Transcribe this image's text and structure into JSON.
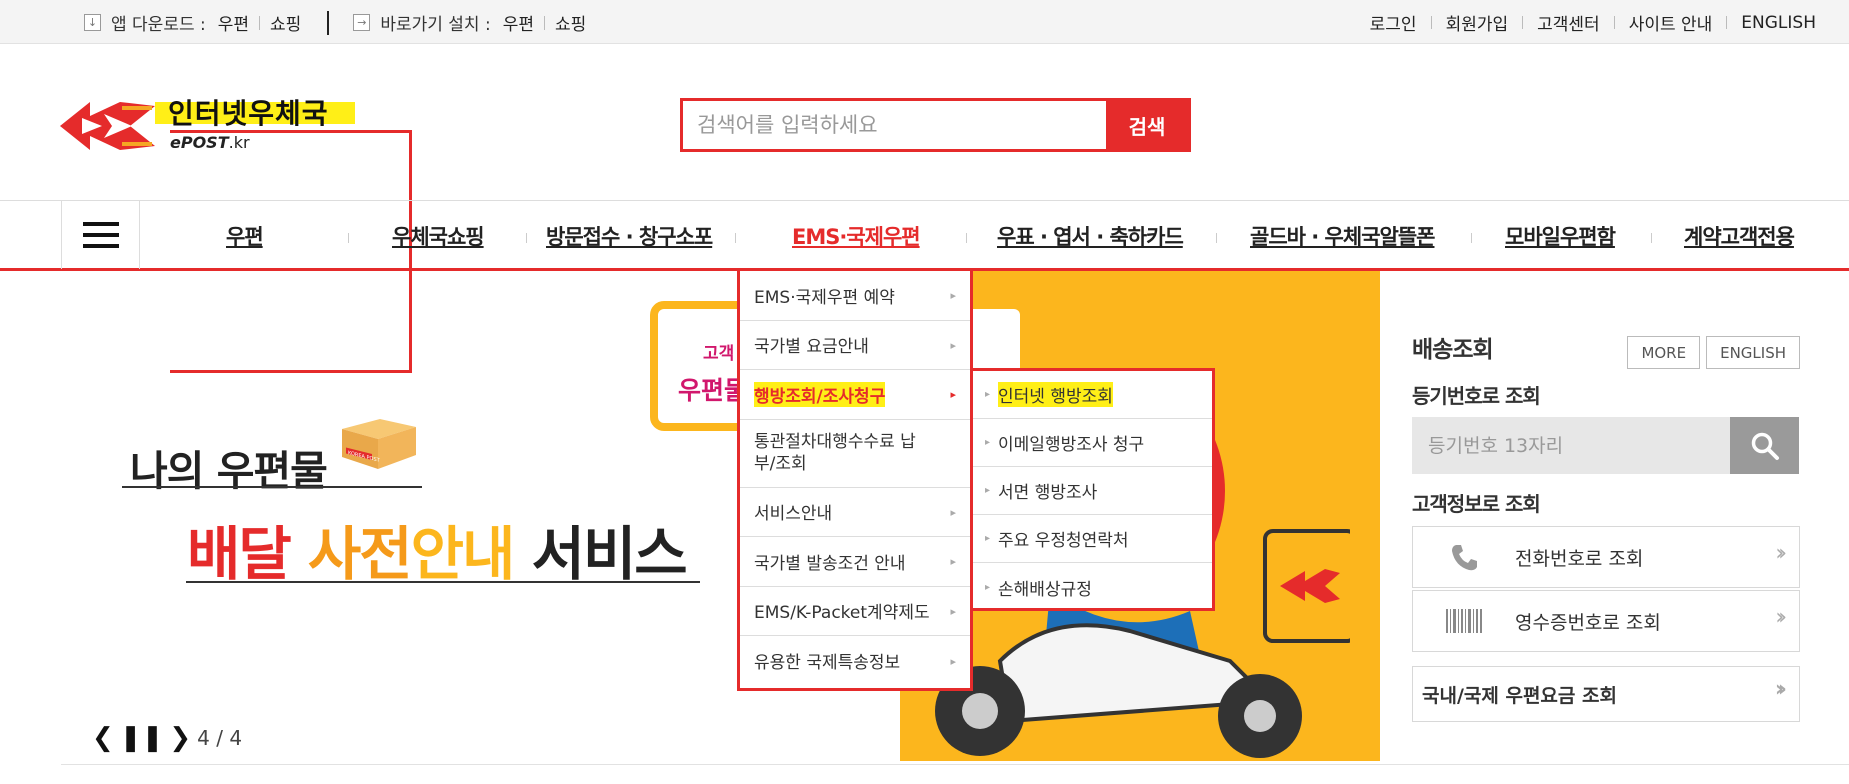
{
  "topbar": {
    "app_download_label": "앱 다운로드 :",
    "app_links": [
      "우편",
      "쇼핑"
    ],
    "shortcut_label": "바로가기 설치 :",
    "shortcut_links": [
      "우편",
      "쇼핑"
    ],
    "right_links": [
      "로그인",
      "회원가입",
      "고객센터",
      "사이트 안내",
      "ENGLISH"
    ]
  },
  "logo": {
    "brand": "인터넷우체국",
    "sub_main": "ePOST",
    "sub_tld": ".kr"
  },
  "search": {
    "placeholder": "검색어를 입력하세요",
    "button": "검색"
  },
  "nav": {
    "items": [
      "우편",
      "우체국쇼핑",
      "방문접수 · 창구소포",
      "EMS·국제우편",
      "우표 · 엽서 · 축하카드",
      "골드바 · 우체국알뜰폰",
      "모바일우편함",
      "계약고객전용"
    ],
    "active_index": 3
  },
  "dropdown": {
    "items": [
      "EMS·국제우편 예약",
      "국가별 요금안내",
      "행방조회/조사청구",
      "통관절차대행수수료 납부/조회",
      "서비스안내",
      "국가별 발송조건 안내",
      "EMS/K-Packet계약제도",
      "유용한 국제특송정보"
    ],
    "active_index": 2,
    "submenu": [
      "인터넷 행방조회",
      "이메일행방조사 청구",
      "서면 행방조사",
      "주요 우정청연락처",
      "손해배상규정"
    ],
    "submenu_active_index": 0
  },
  "hero": {
    "card_line1": "고객",
    "card_line2": "우편물",
    "headline": "나의 우편물",
    "subheadline_parts": [
      "배달 ",
      "사전",
      "안내",
      " 서비스"
    ],
    "box_label": "KOREA POST",
    "slide_counter": "4 / 4"
  },
  "panel": {
    "title": "배송조회",
    "more_button": "MORE",
    "english_button": "ENGLISH",
    "by_number_title": "등기번호로 조회",
    "number_placeholder": "등기번호 13자리",
    "by_customer_title": "고객정보로 조회",
    "phone_lookup": "전화번호로 조회",
    "receipt_lookup": "영수증번호로 조회",
    "rate_lookup": "국내/국제 우편요금 조회"
  },
  "colors": {
    "accent": "#e52b2b",
    "highlight": "#ffef17",
    "hero_yellow": "#fcb61d"
  }
}
